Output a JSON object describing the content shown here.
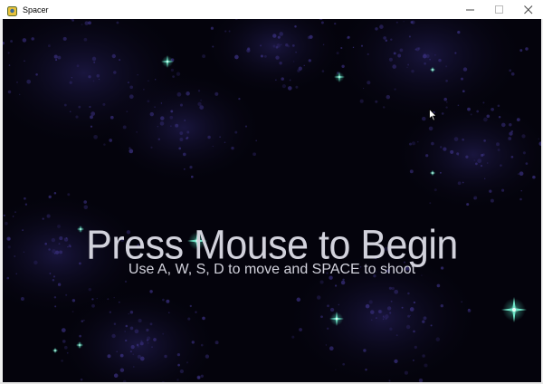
{
  "window": {
    "title": "Spacer",
    "controls": [
      "minimize-icon",
      "maximize-icon",
      "close-icon"
    ]
  },
  "game": {
    "headline": "Press Mouse to Begin",
    "instructions": "Use A, W, S, D to move and SPACE to shoot"
  },
  "colors": {
    "background": "#04030c",
    "nebula": "#3a3080",
    "star": "#6fe6c8",
    "text": "#d2d2dc"
  }
}
